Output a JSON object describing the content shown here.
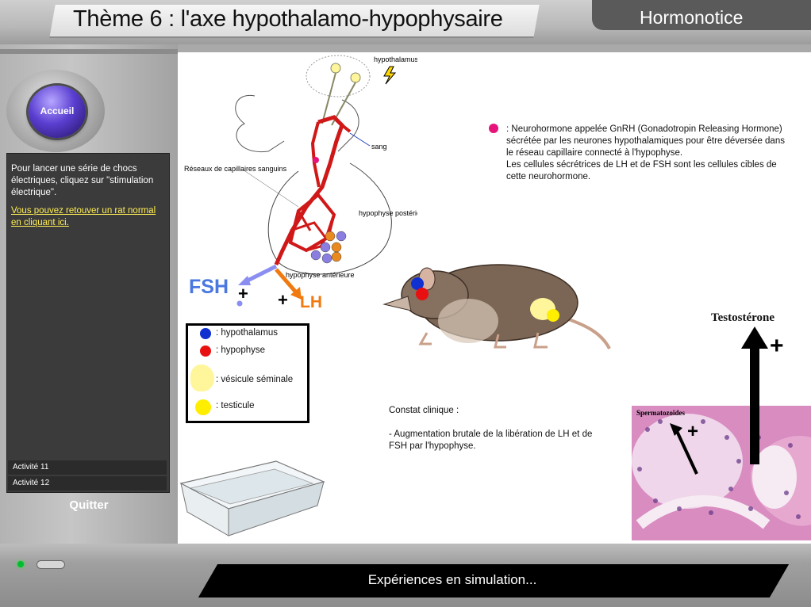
{
  "header": {
    "title": "Thème 6 : l'axe hypothalamo-hypophysaire",
    "brand": "Hormonotice"
  },
  "sidebar": {
    "home_label": "Accueil",
    "instructions": "Pour lancer une série de chocs électriques, cliquez sur \"stimulation électrique\".",
    "reset_link": "Vous pouvez retouver un rat normal en cliquant ici.",
    "activities": [
      {
        "label": "Activité 11"
      },
      {
        "label": "Activité 12"
      }
    ],
    "quit_label": "Quitter"
  },
  "diagram": {
    "labels": {
      "hypothalamus": "hypothalamus",
      "sang": "sang",
      "reseaux": "Réseaux de capillaires sanguins",
      "hypophyse_post": "hypophyse postérieure",
      "hypophyse_ant": "hypophyse antérieure",
      "fsh": "FSH",
      "lh": "LH",
      "plus": "+"
    },
    "colors": {
      "capillaries": "#d01818",
      "fsh": "#4a78e0",
      "lh": "#f07a10",
      "gnrh": "#e6137a"
    }
  },
  "gnrh_note": "Neurohormone appelée GnRH (Gonadotropin Releasing Hormone) sécrétée par les neurones hypothalamiques pour être déversée dans le réseau capillaire connecté à l'hypophyse.\nLes cellules sécrétrices de LH et de FSH sont les cellules cibles de cette neurohormone.",
  "legend": {
    "items": [
      {
        "label": ": hypothalamus",
        "color": "#1030d0"
      },
      {
        "label": ": hypophyse",
        "color": "#e81010"
      },
      {
        "label": ": vésicule séminale",
        "color": "#fff59a"
      },
      {
        "label": ": testicule",
        "color": "#ffee00"
      }
    ]
  },
  "constat": {
    "heading": "Constat clinique :",
    "body": "- Augmentation brutale de la libération de LH et de FSH par l'hypophyse."
  },
  "histology": {
    "arrow_label": "Testostérone",
    "sperm_label": "Spermatozoïdes",
    "plus": "+"
  },
  "status": {
    "text": "Expériences en simulation..."
  }
}
